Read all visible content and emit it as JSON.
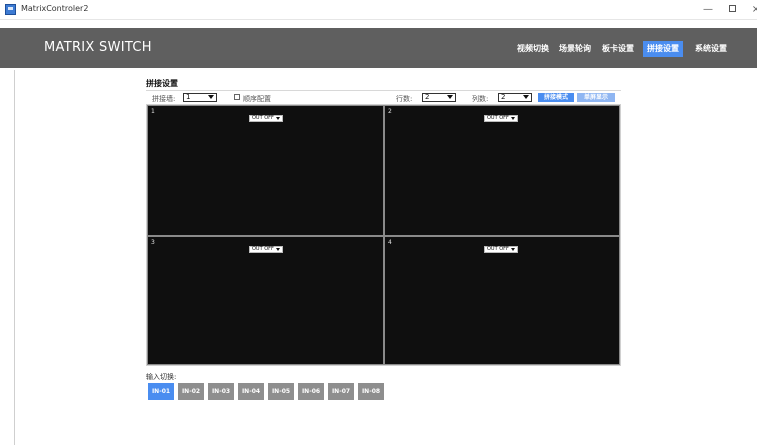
{
  "window": {
    "title": "MatrixControler2",
    "min_glyph": "—",
    "close_glyph": "×"
  },
  "header": {
    "brand": "MATRIX SWITCH",
    "nav": [
      {
        "label": "视频切换",
        "active": false
      },
      {
        "label": "场景轮询",
        "active": false
      },
      {
        "label": "板卡设置",
        "active": false
      },
      {
        "label": "拼接设置",
        "active": true
      },
      {
        "label": "系统设置",
        "active": false
      }
    ]
  },
  "splice": {
    "title": "拼接设置",
    "wall_label": "拼接墙:",
    "wall_value": "1",
    "sync_label": "顺序配置",
    "rows_label": "行数:",
    "rows_value": "2",
    "cols_label": "列数:",
    "cols_value": "2",
    "mode_button": "拼接模式",
    "single_button": "单屏显示"
  },
  "screens": [
    {
      "number": "1",
      "source": "OUT OFF"
    },
    {
      "number": "2",
      "source": "OUT OFF"
    },
    {
      "number": "3",
      "source": "OUT OFF"
    },
    {
      "number": "4",
      "source": "OUT OFF"
    }
  ],
  "inputs": {
    "label": "输入切换:",
    "buttons": [
      {
        "label": "IN-01",
        "active": true
      },
      {
        "label": "IN-02",
        "active": false
      },
      {
        "label": "IN-03",
        "active": false
      },
      {
        "label": "IN-04",
        "active": false
      },
      {
        "label": "IN-05",
        "active": false
      },
      {
        "label": "IN-06",
        "active": false
      },
      {
        "label": "IN-07",
        "active": false
      },
      {
        "label": "IN-08",
        "active": false
      }
    ]
  },
  "colors": {
    "accent": "#4a8df0",
    "header_bg": "#5f5f5f",
    "screen_bg": "#0f0f0f",
    "inactive_input": "#8e8e8e"
  }
}
